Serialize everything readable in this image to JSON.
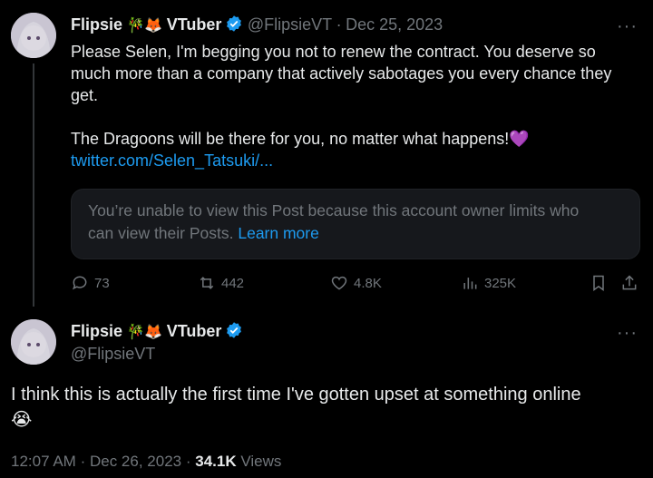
{
  "quoted_tweet": {
    "display_name": "Flipsie",
    "emoji_1": "🎋",
    "emoji_2": "🦊",
    "name_suffix": "VTuber",
    "handle": "@FlipsieVT",
    "separator": "·",
    "date": "Dec 25, 2023",
    "text_line_1": "Please Selen, I'm begging you not to renew the contract. You deserve so",
    "text_line_2": "much more than a company that actively sabotages you every chance they",
    "text_line_3": "get.",
    "text_line_4": "The Dragoons will be there for you, no matter what happens!",
    "heart_emoji": "💜",
    "link": "twitter.com/Selen_Tatsuki/...",
    "restricted_line_1": "You’re unable to view this Post because this account owner limits who",
    "restricted_line_2": "can view their Posts.",
    "learn_more": "Learn more",
    "replies": "73",
    "reposts": "442",
    "likes": "4.8K",
    "views": "325K",
    "more": "···"
  },
  "main_tweet": {
    "display_name": "Flipsie",
    "emoji_1": "🎋",
    "emoji_2": "🦊",
    "name_suffix": "VTuber",
    "handle": "@FlipsieVT",
    "text": "I think this is actually the first time I've gotten upset at something online",
    "emoji_crying": "😭",
    "time": "12:07 AM",
    "separator": "·",
    "date": "Dec 26, 2023",
    "views_count": "34.1K",
    "views_label": "Views",
    "more": "···"
  },
  "colors": {
    "background": "#000000",
    "text": "#e7e9ea",
    "muted": "#71767b",
    "link": "#1d9bf0",
    "verified": "#1d9bf0"
  }
}
